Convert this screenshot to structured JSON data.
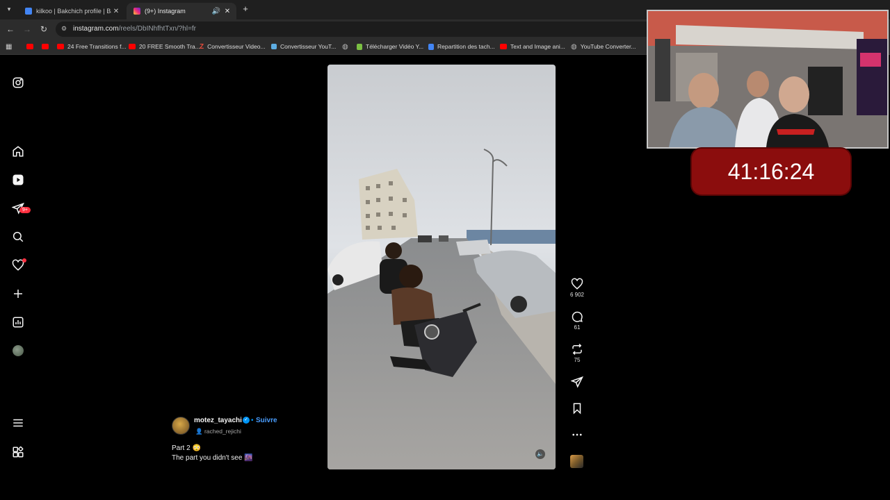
{
  "browser": {
    "tabs": [
      {
        "title": "kilkoo | Bakchich profile | Bakc…",
        "active": false,
        "color": "#4285f4"
      },
      {
        "title": "(9+) Instagram",
        "active": true,
        "color": "#e4405f"
      }
    ],
    "url": {
      "host": "instagram.com",
      "path": "/reels/DbINhfhtTxn/?hl=fr"
    },
    "bookmarks": [
      {
        "label": "",
        "icon": "youtube-icon",
        "color": "#ff0000"
      },
      {
        "label": "",
        "icon": "youtube-icon",
        "color": "#ff0000"
      },
      {
        "label": "24 Free Transitions f...",
        "icon": "youtube-icon",
        "color": "#ff0000"
      },
      {
        "label": "20 FREE Smooth Tra...",
        "icon": "youtube-icon",
        "color": "#ff0000"
      },
      {
        "label": "Convertisseur Video...",
        "icon": "z-icon",
        "color": "#e74c3c"
      },
      {
        "label": "Convertisseur YouT...",
        "icon": "convert-icon",
        "color": "#5dade2"
      },
      {
        "label": "",
        "icon": "globe-icon",
        "color": "#9aa0a6"
      },
      {
        "label": "Télécharger Vidéo Y...",
        "icon": "download-icon",
        "color": "#7bc043"
      },
      {
        "label": "Repartition des tach...",
        "icon": "docs-icon",
        "color": "#4285f4"
      },
      {
        "label": "Text and Image ani...",
        "icon": "youtube-icon",
        "color": "#ff0000"
      },
      {
        "label": "YouTube Converter...",
        "icon": "globe-icon",
        "color": "#9aa0a6"
      }
    ]
  },
  "sidebar": {
    "messages_badge": "9+",
    "items": [
      "instagram-logo",
      "home",
      "reels",
      "messages",
      "search",
      "notifications",
      "create",
      "dashboard",
      "profile",
      "more",
      "also-from-meta"
    ]
  },
  "reel": {
    "likes": "6 902",
    "comments": "61",
    "reposts": "75",
    "author": "motez_tayachi",
    "follow_label": "Suivre",
    "collaborator": "rached_rejichi",
    "caption_line1": "Part 2 😳",
    "caption_line2": "The part you didn't see 🌆"
  },
  "overlay": {
    "timer": "41:16:24"
  }
}
